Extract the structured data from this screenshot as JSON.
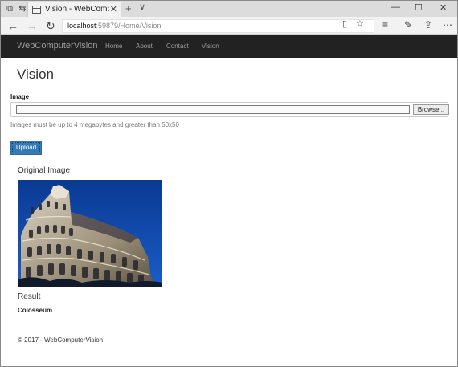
{
  "browser": {
    "tab_title": "Vision - WebComputerV",
    "tab_close": "✕",
    "new_tab": "+",
    "tab_menu": "∨",
    "url_host": "localhost",
    "url_rest": ":59879/Home/Vision",
    "window_controls": {
      "minimize": "—",
      "maximize": "☐",
      "close": "✕"
    },
    "icons": [
      "back-icon",
      "forward-icon",
      "refresh-icon",
      "reading-view-icon",
      "favorite-star-icon",
      "hub-icon",
      "pen-icon",
      "share-icon",
      "more-icon"
    ]
  },
  "site": {
    "brand": "WebComputerVision",
    "nav": [
      "Home",
      "About",
      "Contact",
      "Vision"
    ]
  },
  "page": {
    "title": "Vision",
    "image_label": "Image",
    "browse_label": "Browse...",
    "help_text": "Images must be up to 4 megabytes and greater than 50x50",
    "upload_label": "Upload",
    "original_heading": "Original Image",
    "result_heading": "Result",
    "result_value": "Colosseum"
  },
  "footer": {
    "text": "© 2017 - WebComputerVision"
  },
  "colors": {
    "site_nav_bg": "#222222",
    "nav_text": "#9d9d9d",
    "primary_button": "#337ab7",
    "night_sky": "#0b3f9a"
  }
}
